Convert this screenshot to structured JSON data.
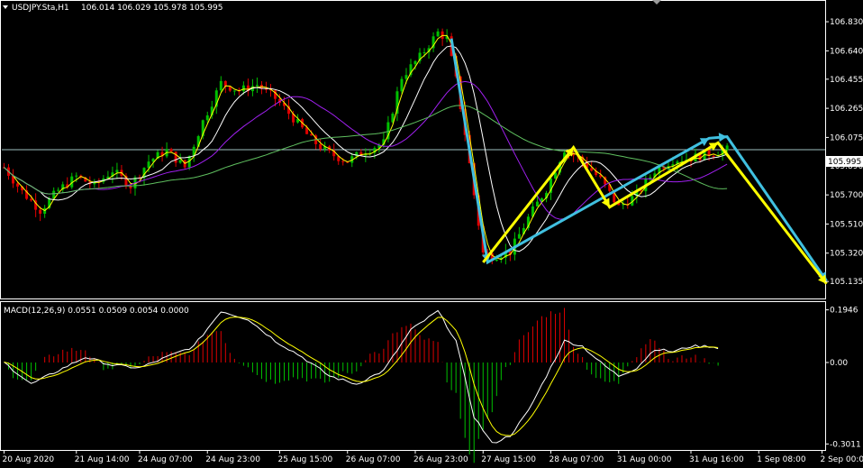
{
  "main_header": {
    "symbol": "USDJPY.Sta,H1",
    "ohlc": "106.014 106.029 105.978 105.995"
  },
  "macd_header": {
    "label": "MACD(12,26,9) 0.0551 0.0509 0.0054 0.0000"
  },
  "current_price_label": "105.995",
  "colors": {
    "background": "#000000",
    "grid": "#ffffff",
    "bull": "#00c000",
    "bear": "#e00000",
    "ma_fast": "#ffff00",
    "ma_white": "#ffffff",
    "ma_purple": "#a020f0",
    "ma_green": "#5fbf5f",
    "arrow_cyan": "#40c0e0",
    "arrow_yellow": "#ffff00",
    "price_line": "#a0c0c0"
  },
  "chart_data": [
    {
      "type": "candlestick",
      "title": "USDJPY.Sta,H1",
      "ylim": [
        105.03,
        106.96
      ],
      "y_ticks": [
        "106.830",
        "106.640",
        "106.455",
        "106.265",
        "106.075",
        "105.890",
        "105.700",
        "105.510",
        "105.320",
        "105.135"
      ],
      "y_tick_values": [
        106.83,
        106.64,
        106.455,
        106.265,
        106.075,
        105.89,
        105.7,
        105.51,
        105.32,
        105.135
      ],
      "x_labels": [
        "20 Aug 2020",
        "21 Aug 14:00",
        "24 Aug 07:00",
        "24 Aug 23:00",
        "25 Aug 15:00",
        "26 Aug 07:00",
        "26 Aug 23:00",
        "27 Aug 15:00",
        "28 Aug 07:00",
        "31 Aug 00:00",
        "31 Aug 16:00",
        "1 Sep 08:00",
        "2 Sep 00:00"
      ],
      "current_price": 105.995,
      "price_path": [
        [
          0,
          105.88
        ],
        [
          4,
          105.72
        ],
        [
          8,
          105.6
        ],
        [
          12,
          105.73
        ],
        [
          16,
          105.82
        ],
        [
          20,
          105.76
        ],
        [
          24,
          105.86
        ],
        [
          28,
          105.76
        ],
        [
          32,
          105.92
        ],
        [
          36,
          105.99
        ],
        [
          40,
          105.88
        ],
        [
          44,
          106.18
        ],
        [
          48,
          106.43
        ],
        [
          52,
          106.38
        ],
        [
          56,
          106.42
        ],
        [
          60,
          106.33
        ],
        [
          64,
          106.2
        ],
        [
          68,
          106.06
        ],
        [
          72,
          105.97
        ],
        [
          76,
          105.92
        ],
        [
          80,
          105.99
        ],
        [
          84,
          106.04
        ],
        [
          88,
          106.47
        ],
        [
          92,
          106.6
        ],
        [
          96,
          106.76
        ],
        [
          98,
          106.72
        ],
        [
          100,
          106.45
        ],
        [
          102,
          106.1
        ],
        [
          104,
          105.7
        ],
        [
          106,
          105.32
        ],
        [
          108,
          105.3
        ],
        [
          112,
          105.33
        ],
        [
          116,
          105.55
        ],
        [
          120,
          105.74
        ],
        [
          124,
          106.0
        ],
        [
          128,
          105.92
        ],
        [
          132,
          105.8
        ],
        [
          136,
          105.62
        ],
        [
          140,
          105.7
        ],
        [
          144,
          105.86
        ],
        [
          148,
          105.93
        ],
        [
          152,
          105.94
        ],
        [
          156,
          105.97
        ],
        [
          160,
          105.995
        ]
      ],
      "moving_averages": [
        {
          "name": "fast",
          "color": "#ffff00",
          "lag": 1
        },
        {
          "name": "medium",
          "color": "#ffffff",
          "lag": 4
        },
        {
          "name": "slow",
          "color": "#a020f0",
          "lag": 10
        },
        {
          "name": "long",
          "color": "#5fbf5f",
          "lag": 28
        }
      ],
      "projection_lines": [
        {
          "color": "#40c0e0",
          "points": [
            [
              99,
              106.72
            ],
            [
              107,
              105.26
            ],
            [
              156,
              106.07
            ],
            [
              160,
              106.08
            ],
            [
              182,
              105.14
            ]
          ]
        },
        {
          "color": "#ffff00",
          "points": [
            [
              106,
              105.26
            ],
            [
              126,
              106.01
            ],
            [
              134,
              105.62
            ],
            [
              158,
              106.04
            ],
            [
              182,
              105.12
            ]
          ]
        }
      ]
    },
    {
      "type": "histogram+line",
      "title": "MACD(12,26,9)",
      "values_shown": {
        "macd": 0.0551,
        "signal": 0.0509,
        "histogram": 0.0054,
        "extra": 0.0
      },
      "ylim": [
        -0.32,
        0.22
      ],
      "y_ticks": [
        "0.1946",
        "0.00",
        "-0.3011"
      ],
      "y_tick_values": [
        0.1946,
        0.0,
        -0.3011
      ],
      "macd_path": [
        [
          0,
          0.0
        ],
        [
          6,
          -0.08
        ],
        [
          12,
          -0.03
        ],
        [
          18,
          0.02
        ],
        [
          24,
          -0.01
        ],
        [
          30,
          -0.02
        ],
        [
          36,
          0.02
        ],
        [
          42,
          0.06
        ],
        [
          48,
          0.19
        ],
        [
          54,
          0.16
        ],
        [
          60,
          0.08
        ],
        [
          66,
          0.02
        ],
        [
          72,
          -0.05
        ],
        [
          78,
          -0.08
        ],
        [
          84,
          -0.03
        ],
        [
          90,
          0.12
        ],
        [
          96,
          0.19
        ],
        [
          100,
          0.08
        ],
        [
          104,
          -0.2
        ],
        [
          108,
          -0.3
        ],
        [
          112,
          -0.27
        ],
        [
          116,
          -0.18
        ],
        [
          120,
          -0.05
        ],
        [
          124,
          0.08
        ],
        [
          128,
          0.06
        ],
        [
          132,
          0.0
        ],
        [
          136,
          -0.05
        ],
        [
          140,
          -0.02
        ],
        [
          144,
          0.05
        ],
        [
          148,
          0.04
        ],
        [
          152,
          0.06
        ],
        [
          156,
          0.06
        ],
        [
          158,
          0.0551
        ]
      ],
      "signal_lag": 5
    }
  ]
}
